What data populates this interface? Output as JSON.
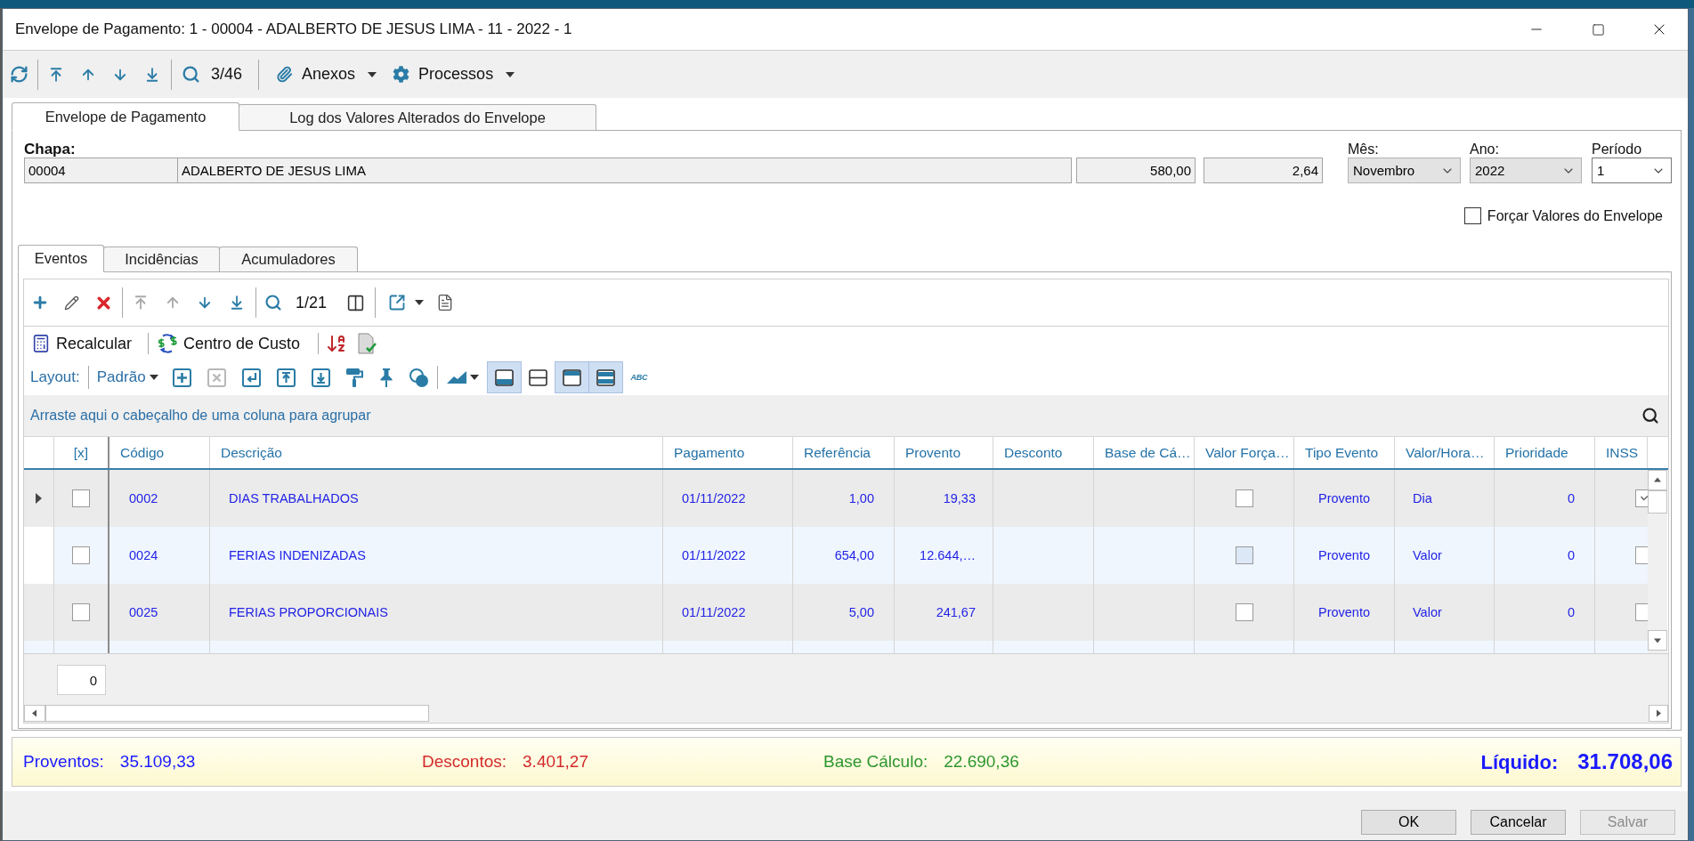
{
  "window": {
    "title": "Envelope de Pagamento: 1 - 00004 - ADALBERTO DE JESUS LIMA - 11 - 2022 - 1"
  },
  "toolbar": {
    "counter": "3/46",
    "menus": [
      {
        "kind": "attachments",
        "label": "Anexos"
      },
      {
        "kind": "processes",
        "label": "Processos"
      }
    ]
  },
  "tabs": [
    {
      "label": "Envelope de Pagamento",
      "selected": true
    },
    {
      "label": "Log dos Valores Alterados do Envelope",
      "selected": false
    }
  ],
  "header": {
    "chapa_label": "Chapa:",
    "chapa": "00004",
    "name": "ADALBERTO DE JESUS LIMA",
    "field_3": "580,00",
    "field_4": "2,64",
    "selects": [
      {
        "label": "Mês:",
        "value": "Novembro",
        "disabled": true
      },
      {
        "label": "Ano:",
        "value": "2022",
        "disabled": true
      },
      {
        "label": "Período",
        "value": "1",
        "disabled": false
      }
    ],
    "force_values": {
      "label": "Forçar Valores do Envelope",
      "checked": false
    }
  },
  "inner_tabs": [
    {
      "label": "Eventos",
      "selected": true
    },
    {
      "label": "Incidências",
      "selected": false
    },
    {
      "label": "Acumuladores",
      "selected": false
    }
  ],
  "events_toolbar": {
    "nav": [
      {
        "kind": "first",
        "disabled": true
      },
      {
        "kind": "up",
        "disabled": true
      },
      {
        "kind": "down",
        "disabled": false
      },
      {
        "kind": "last",
        "disabled": false
      }
    ],
    "counter": "1/21"
  },
  "actions": [
    {
      "kind": "calculator",
      "label": "Recalcular"
    },
    {
      "kind": "cost-center",
      "label": "Centro de Custo"
    }
  ],
  "layout_bar": {
    "label": "Layout:",
    "preset": "Padrão",
    "tools": [
      {
        "kind": "add",
        "disabled": false
      },
      {
        "kind": "remove",
        "disabled": true
      },
      {
        "kind": "enter",
        "disabled": false
      },
      {
        "kind": "import",
        "disabled": false
      },
      {
        "kind": "export",
        "disabled": false
      },
      {
        "kind": "format",
        "disabled": false
      },
      {
        "kind": "pin",
        "disabled": false
      },
      {
        "kind": "shapes",
        "disabled": false
      }
    ],
    "views": [
      {
        "kind": "bottom",
        "selected": true
      },
      {
        "kind": "split",
        "selected": false
      },
      {
        "kind": "top",
        "selected": true
      },
      {
        "kind": "rows",
        "selected": true
      }
    ],
    "spell": "ABC"
  },
  "group_panel": {
    "hint": "Arraste aqui o cabeçalho de uma coluna para agrupar"
  },
  "table": {
    "columns": [
      {
        "label": "[x]"
      },
      {
        "label": "Código"
      },
      {
        "label": "Descrição"
      },
      {
        "label": "Pagamento"
      },
      {
        "label": "Referência"
      },
      {
        "label": "Provento"
      },
      {
        "label": "Desconto"
      },
      {
        "label": "Base de Cá…"
      },
      {
        "label": "Valor Força…"
      },
      {
        "label": "Tipo Evento"
      },
      {
        "label": "Valor/Hora…"
      },
      {
        "label": "Prioridade"
      },
      {
        "label": "INSS"
      }
    ],
    "rows": [
      {
        "selected": true,
        "checked": false,
        "code": "0002",
        "description": "DIAS TRABALHADOS",
        "payment": "01/11/2022",
        "reference": "1,00",
        "provento": "19,33",
        "forced": false,
        "type": "Provento",
        "unit": "Dia",
        "priority": "0",
        "inss": true
      },
      {
        "selected": false,
        "checked": false,
        "code": "0024",
        "description": "FERIAS INDENIZADAS",
        "payment": "01/11/2022",
        "reference": "654,00",
        "provento": "12.644,…",
        "forced": false,
        "type": "Provento",
        "unit": "Valor",
        "priority": "0",
        "inss": false
      },
      {
        "selected": false,
        "checked": false,
        "code": "0025",
        "description": "FERIAS PROPORCIONAIS",
        "payment": "01/11/2022",
        "reference": "5,00",
        "provento": "241,67",
        "forced": false,
        "type": "Provento",
        "unit": "Valor",
        "priority": "0",
        "inss": false
      }
    ]
  },
  "record_count": "0",
  "summary": {
    "items": [
      {
        "label": "Proventos:",
        "value": "35.109,33",
        "color": "#1a1aff"
      },
      {
        "label": "Descontos:",
        "value": "3.401,27",
        "color": "#d42a2a"
      },
      {
        "label": "Base Cálculo:",
        "value": "22.690,36",
        "color": "#2e962e"
      }
    ],
    "total": {
      "label": "Líquido:",
      "value": "31.708,06"
    }
  },
  "buttons": [
    {
      "label": "OK",
      "disabled": false
    },
    {
      "label": "Cancelar",
      "disabled": false
    },
    {
      "label": "Salvar",
      "disabled": true
    }
  ]
}
